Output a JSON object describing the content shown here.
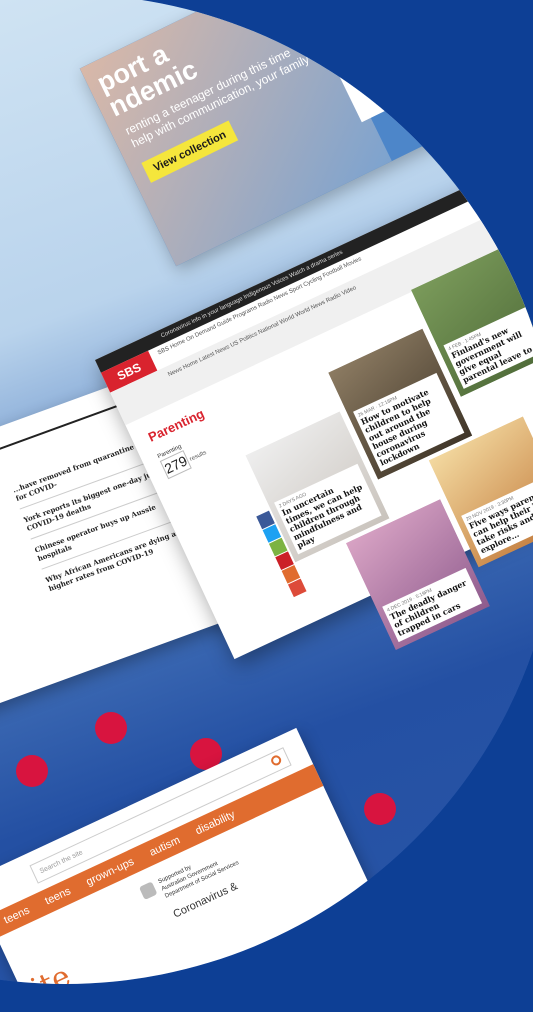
{
  "colors": {
    "background": "#0d3f95",
    "accent_red": "#d8143f",
    "sbs_red": "#d9232e",
    "orange": "#e06c2f",
    "yellow": "#f5e63c"
  },
  "top_card": {
    "headline_1": "port a",
    "headline_2": "ndemic",
    "sub_1": "renting a teenager during this time",
    "sub_2": "help with communication, your family's",
    "button": "View collection",
    "brand": "Suppo"
  },
  "sbs": {
    "logo": "SBS",
    "topbar": "Coronavirus info in your language    Indigenous    Voices    Watch a drama series",
    "nav": "SBS Home   On Demand   Guide   Programs   Radio   News   Sport   Cycling   Football   Movies",
    "subnav": "News Home   Latest News   US Politics   National   World   World News Radio   Video",
    "page_title": "Parenting",
    "count_label": "Parenting",
    "count": "279",
    "results_label": "results",
    "tiles": [
      {
        "meta": "2 DAYS AGO",
        "title": "In uncertain times, we can help children through mindfulness and play"
      },
      {
        "meta": "26 MAR · 12:18PM",
        "title": "How to motivate children to help out around the house during coronavirus lockdown"
      },
      {
        "meta": "4 FEB · 1:45PM",
        "title": "Finland's new government will give equal parental leave to..."
      },
      {
        "meta": "4 DEC 2019 · 5:19PM",
        "title": "The deadly danger of children trapped in cars"
      },
      {
        "meta": "20 NOV 2019 · 3:30PM",
        "title": "Five ways parents can help their kids take risks and explore..."
      }
    ]
  },
  "news": {
    "items": [
      "...have removed from quarantine hotel for COVID-",
      "York reports its biggest one-day jump in COVID-19 deaths",
      "Chinese operator buys up Aussie hospitals",
      "Why African Americans are dying at higher rates from COVID-19"
    ]
  },
  "site": {
    "search_placeholder": "Search the site",
    "nav": [
      "teens",
      "teens",
      "grown-ups",
      "autism",
      "disability"
    ],
    "gov_1": "Supported by",
    "gov_2": "Australian Government",
    "gov_3": "Department of Social Services",
    "big": "ite",
    "coronavirus": "Coronavirus &"
  }
}
